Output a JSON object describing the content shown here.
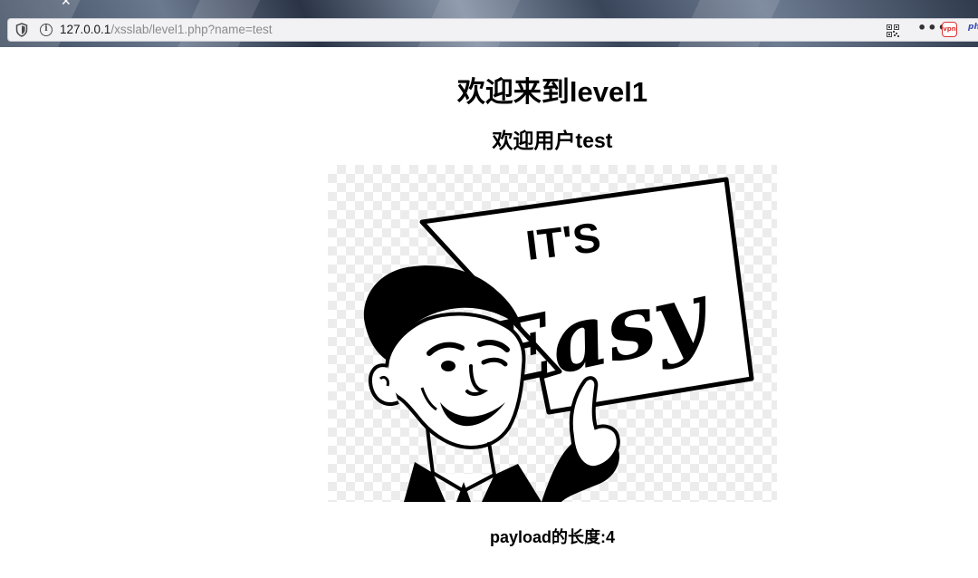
{
  "browser": {
    "tab_close_glyph": "✕",
    "url_host": "127.0.0.1",
    "url_path": "/xsslab/level1.php?name=test",
    "php_label": "php",
    "ext_label": "vpn"
  },
  "page": {
    "heading": "欢迎来到level1",
    "subheading": "欢迎用户test",
    "sign_line1": "IT'S",
    "sign_line2": "Easy",
    "payload_length_text": "payload的长度:4"
  }
}
